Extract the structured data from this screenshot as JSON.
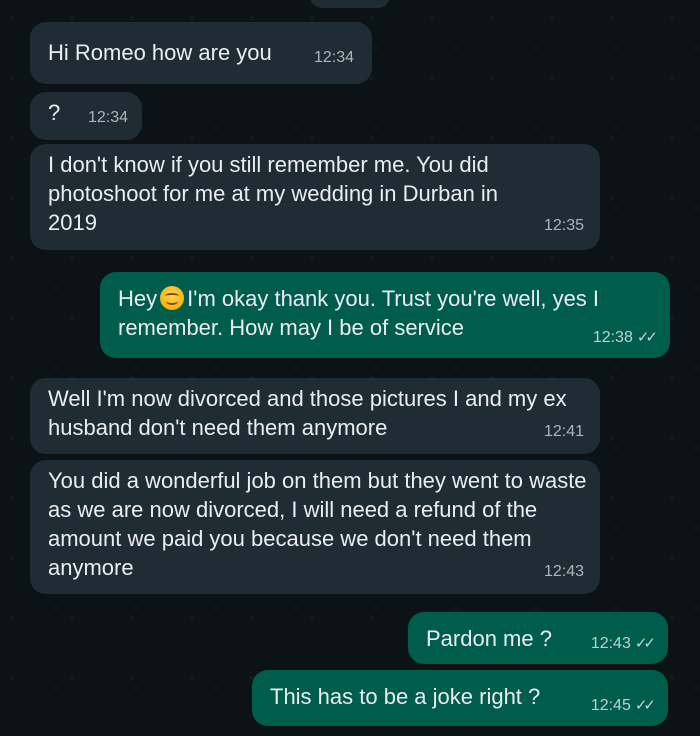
{
  "messages": [
    {
      "dir": "in",
      "text": "Hi Romeo how are you",
      "time": "12:34"
    },
    {
      "dir": "in",
      "text": "?",
      "time": "12:34"
    },
    {
      "dir": "in",
      "text": "I don't know if you still remember me. You did photoshoot for me at my wedding in Durban in 2019",
      "time": "12:35"
    },
    {
      "dir": "out",
      "text_pre": "Hey",
      "emoji": "smiling-face-emoji",
      "text_post": "I'm okay thank you. Trust you're well, yes I remember. How may I be of service",
      "time": "12:38",
      "status": "read"
    },
    {
      "dir": "in",
      "text": "Well I'm now divorced and those pictures I and my ex husband don't need them anymore",
      "time": "12:41"
    },
    {
      "dir": "in",
      "text": "You did a wonderful job on them but they went to waste as we are now divorced, I will need a refund of the amount we paid you because we don't need them anymore",
      "time": "12:43"
    },
    {
      "dir": "out",
      "text": "Pardon me ?",
      "time": "12:43",
      "status": "read"
    },
    {
      "dir": "out",
      "text": "This has to be a joke right ?",
      "time": "12:45",
      "status": "read"
    }
  ],
  "colors": {
    "background": "#0c1317",
    "incoming_bubble": "#202c33",
    "outgoing_bubble": "#005c4b",
    "read_ticks": "#c6d6d2"
  },
  "icons": {
    "read_receipt": "double-check-icon"
  }
}
